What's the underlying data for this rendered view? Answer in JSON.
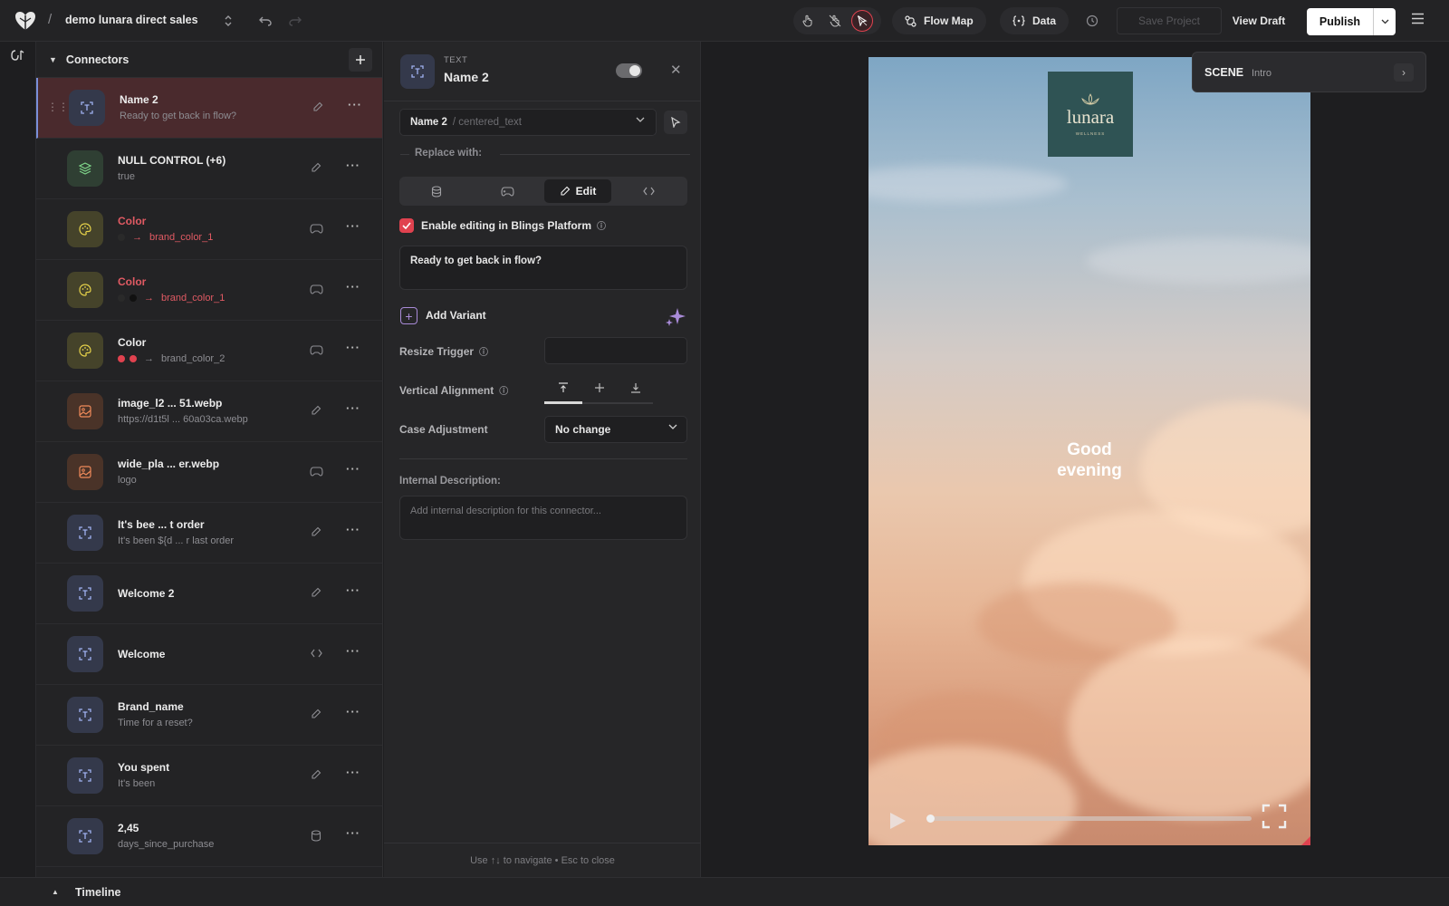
{
  "app": {
    "project_name": "demo lunara direct sales",
    "separator": "/"
  },
  "toolbar": {
    "flow_map_label": "Flow Map",
    "data_label": "Data",
    "save_label": "Save Project",
    "view_draft_label": "View Draft",
    "publish_label": "Publish"
  },
  "connectors": {
    "title": "Connectors",
    "items": [
      {
        "name": "Name 2",
        "sub": "Ready to get back in flow?",
        "icon": "text-icon",
        "action_icon": "edit-icon",
        "selected": true
      },
      {
        "name": "NULL CONTROL (+6)",
        "sub": "true",
        "icon": "layers-icon",
        "action_icon": "edit-icon"
      },
      {
        "name": "Color",
        "sub": "brand_color_1",
        "icon": "palette-icon",
        "action_icon": "gamepad-icon",
        "red": true
      },
      {
        "name": "Color",
        "sub": "brand_color_1",
        "icon": "palette-icon",
        "action_icon": "gamepad-icon",
        "red": true
      },
      {
        "name": "Color",
        "sub": "brand_color_2",
        "icon": "palette-icon",
        "action_icon": "gamepad-icon"
      },
      {
        "name": "image_l2 ... 51.webp",
        "sub": "https://d1t5l ... 60a03ca.webp",
        "icon": "image-icon",
        "action_icon": "edit-icon"
      },
      {
        "name": "wide_pla ... er.webp",
        "sub": "logo",
        "icon": "image-icon",
        "action_icon": "gamepad-icon"
      },
      {
        "name": "It's bee ... t order",
        "sub": "It's been ${d ... r last order",
        "icon": "text-icon",
        "action_icon": "edit-icon"
      },
      {
        "name": "Welcome 2",
        "sub": "",
        "icon": "text-icon",
        "action_icon": "edit-icon"
      },
      {
        "name": "Welcome",
        "sub": "",
        "icon": "text-icon",
        "action_icon": "code-icon"
      },
      {
        "name": "Brand_name",
        "sub": "Time for a reset?",
        "icon": "text-icon",
        "action_icon": "edit-icon"
      },
      {
        "name": "You spent",
        "sub": "It's been",
        "icon": "text-icon",
        "action_icon": "edit-icon"
      },
      {
        "name": "2,45",
        "sub": "days_since_purchase",
        "icon": "text-icon",
        "action_icon": "database-icon"
      }
    ]
  },
  "details": {
    "type": "TEXT",
    "name": "Name 2",
    "layer_name": "Name 2",
    "layer_path": "/ centered_text",
    "replace_label": "Replace with:",
    "edit_tab_label": "Edit",
    "enable_label": "Enable editing in Blings Platform",
    "enable_checked": true,
    "text_value": "Ready to get back in flow?",
    "add_variant_label": "Add Variant",
    "resize_trigger_label": "Resize Trigger",
    "vertical_alignment_label": "Vertical Alignment",
    "case_adjustment_label": "Case Adjustment",
    "case_adjustment_value": "No change",
    "description_label": "Internal Description:",
    "description_placeholder": "Add internal description for this connector...",
    "footer_hint": "Use ↑↓ to navigate • Esc to close"
  },
  "preview": {
    "brand": "lunara",
    "brand_sub": "WELLNESS",
    "greeting_line1": "Good",
    "greeting_line2": "evening",
    "progress": 0.0
  },
  "scene": {
    "label": "SCENE",
    "value": "Intro"
  },
  "timeline": {
    "label": "Timeline"
  },
  "colors": {
    "accent_red": "#e0424f",
    "selected_row": "#4a2a2d",
    "publish_bg": "#ffffff"
  }
}
